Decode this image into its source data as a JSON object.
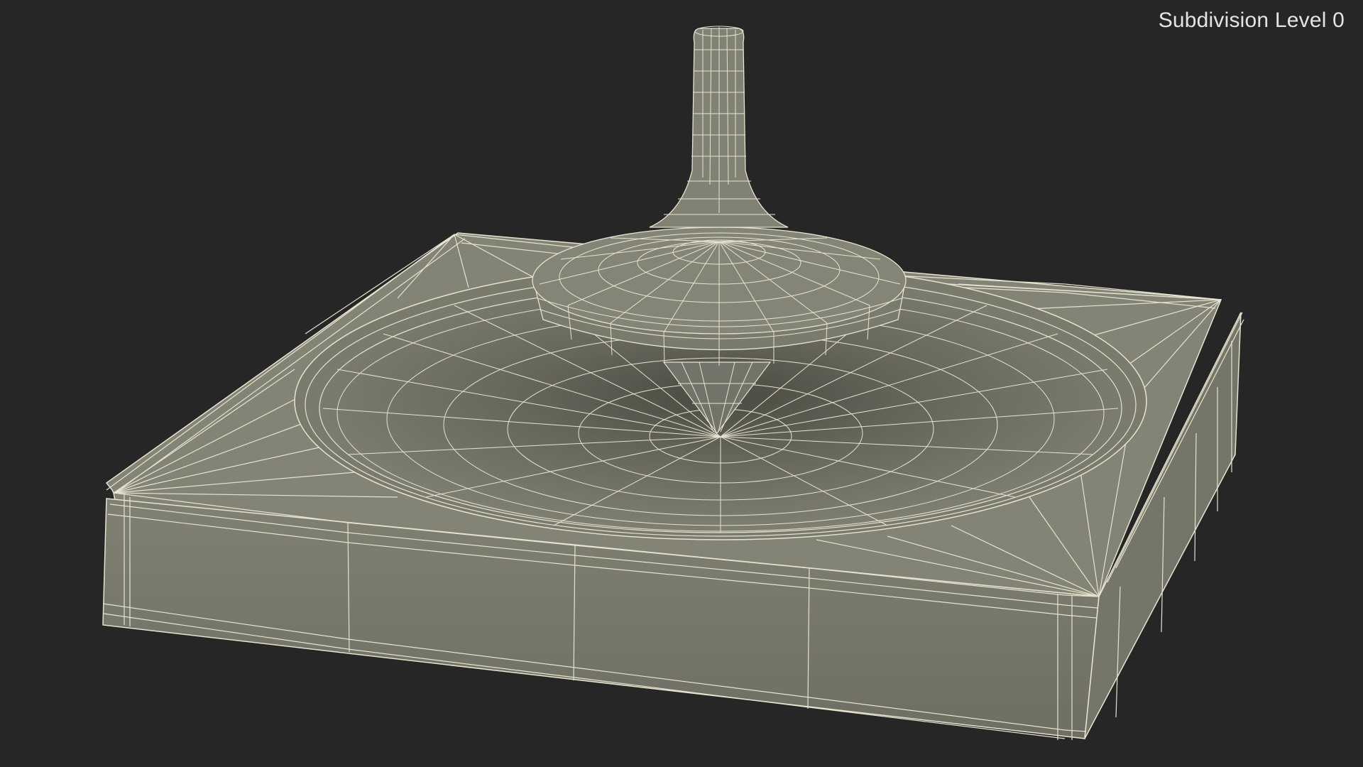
{
  "viewport": {
    "overlay_label": "Subdivision Level 0",
    "background_color": "#262626",
    "mesh_fill_color": "#7d7d70",
    "wire_color": "#e6e4cf"
  },
  "scene": {
    "object": "spinning top on square base with bowl",
    "display_mode": "shaded wireframe"
  }
}
